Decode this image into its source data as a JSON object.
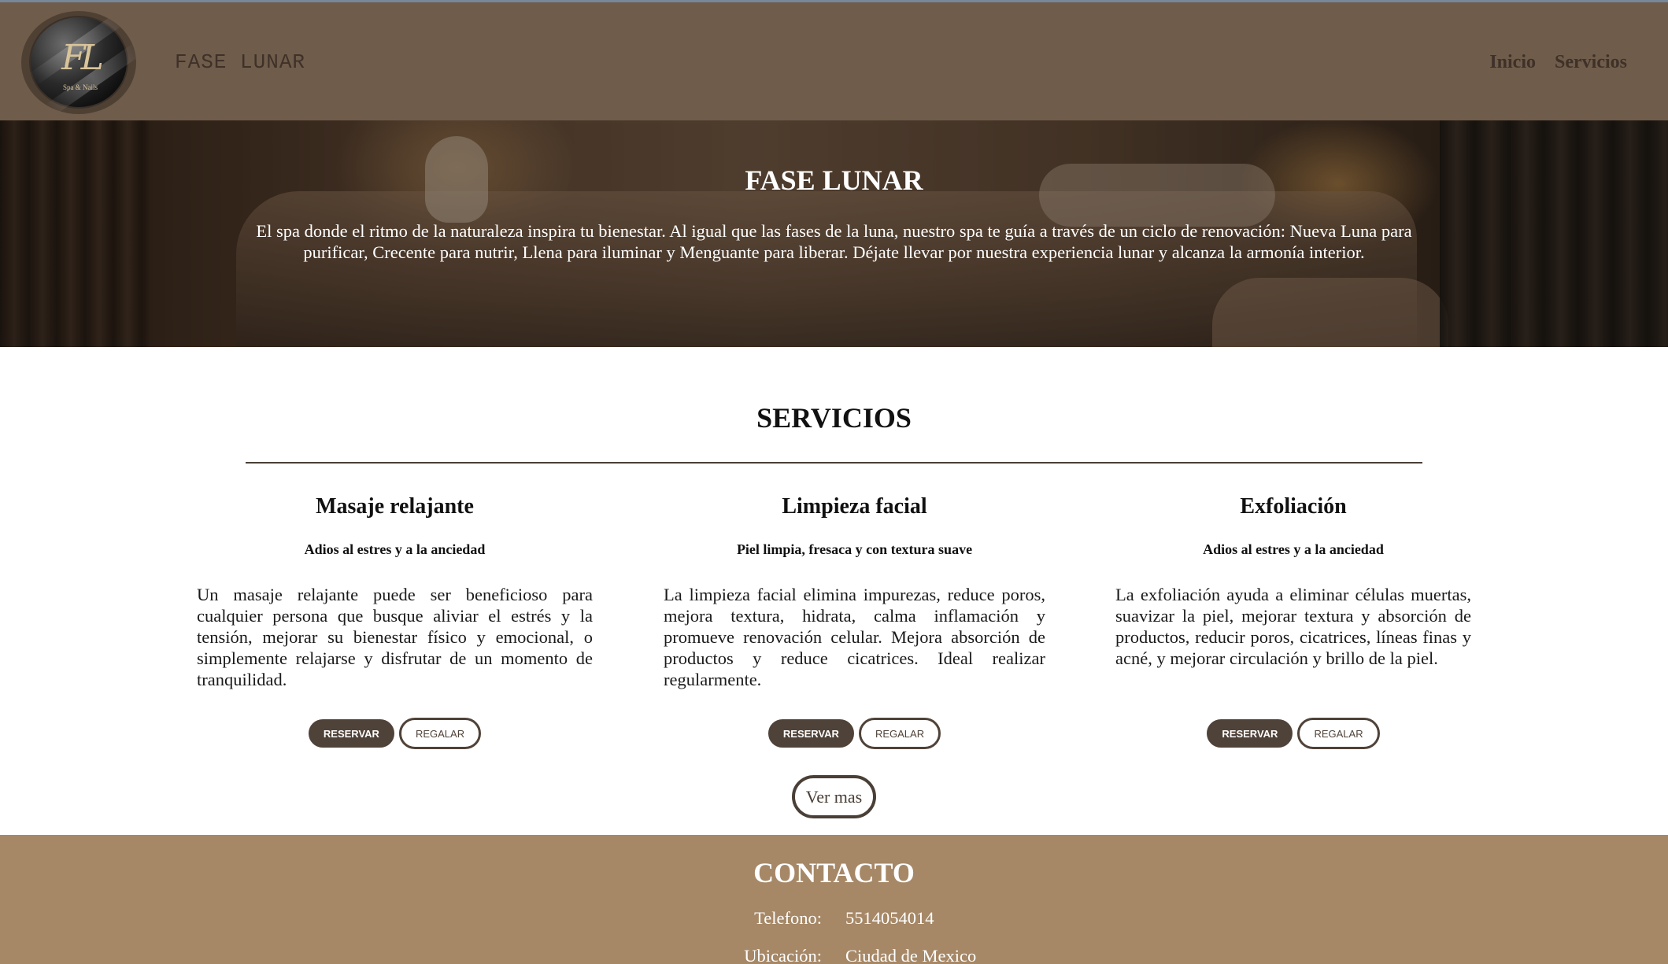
{
  "navbar": {
    "logo": {
      "monogram": "FL",
      "tagline": "Spa & Nails"
    },
    "brand": "FASE LUNAR",
    "links": [
      {
        "label": "Inicio"
      },
      {
        "label": "Servicios"
      }
    ]
  },
  "hero": {
    "title": "FASE LUNAR",
    "description": "El spa donde el ritmo de la naturaleza inspira tu bienestar. Al igual que las fases de la luna, nuestro spa te guía a través de un ciclo de renovación: Nueva Luna para purificar, Crecente para nutrir, Llena para iluminar y Menguante para liberar. Déjate llevar por nuestra experiencia lunar y alcanza la armonía interior."
  },
  "services": {
    "title": "SERVICIOS",
    "items": [
      {
        "title": "Masaje relajante",
        "subtitle": "Adios al estres y a la anciedad",
        "description": "Un masaje relajante puede ser beneficioso para cualquier persona que busque aliviar el estrés y la tensión, mejorar su bienestar físico y emocional, o simplemente relajarse y disfrutar de un momento de tranquilidad.",
        "reserve_label": "RESERVAR",
        "gift_label": "REGALAR"
      },
      {
        "title": "Limpieza facial",
        "subtitle": "Piel limpia, fresaca y con textura suave",
        "description": "La limpieza facial elimina impurezas, reduce poros, mejora textura, hidrata, calma inflamación y promueve renovación celular. Mejora absorción de productos y reduce cicatrices. Ideal realizar regularmente.",
        "reserve_label": "RESERVAR",
        "gift_label": "REGALAR"
      },
      {
        "title": "Exfoliación",
        "subtitle": "Adios al estres y a la anciedad",
        "description": "La exfoliación ayuda a eliminar células muertas, suavizar la piel, mejorar textura y absorción de productos, reducir poros, cicatrices, líneas finas y acné, y mejorar circulación y brillo de la piel.",
        "reserve_label": "RESERVAR",
        "gift_label": "REGALAR"
      }
    ],
    "more_label": "Ver mas"
  },
  "contact": {
    "title": "CONTACTO",
    "rows": [
      {
        "label": "Telefono:",
        "value": "5514054014"
      },
      {
        "label": "Ubicación:",
        "value": "Ciudad de Mexico"
      }
    ]
  },
  "colors": {
    "navbar": "#6f5c4b",
    "accent": "#4f4238",
    "contact_bg": "#a68867"
  }
}
